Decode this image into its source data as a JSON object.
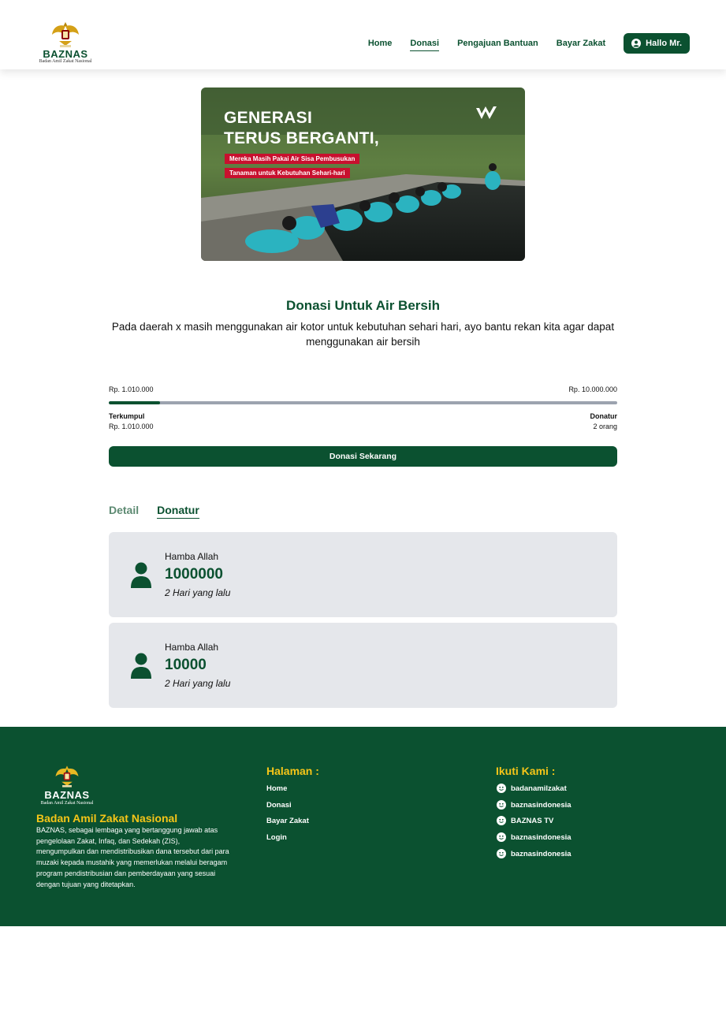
{
  "header": {
    "logo": {
      "brand": "BAZNAS",
      "subtitle": "Badan Amil Zakat Nasional"
    },
    "nav": [
      {
        "label": "Home"
      },
      {
        "label": "Donasi",
        "active": true
      },
      {
        "label": "Pengajuan Bantuan"
      },
      {
        "label": "Bayar Zakat"
      }
    ],
    "user_button": "Hallo Mr."
  },
  "banner": {
    "headline_line1": "GENERASI",
    "headline_line2": "TERUS BERGANTI,",
    "tag1": "Mereka Masih Pakai Air Sisa Pembusukan",
    "tag2": "Tanaman untuk Kebutuhan Sehari-hari"
  },
  "campaign": {
    "title": "Donasi Untuk Air Bersih",
    "description": "Pada daerah x masih menggunakan air kotor untuk kebutuhan sehari hari, ayo bantu rekan kita agar dapat menggunakan air bersih",
    "collected_top": "Rp. 1.010.000",
    "target": "Rp. 10.000.000",
    "progress_fraction": 0.101,
    "collected_label": "Terkumpul",
    "collected_value": "Rp. 1.010.000",
    "donor_label": "Donatur",
    "donor_value": "2 orang",
    "donate_button": "Donasi Sekarang"
  },
  "tabs": [
    {
      "label": "Detail",
      "active": false
    },
    {
      "label": "Donatur",
      "active": true
    }
  ],
  "donors": [
    {
      "name": "Hamba Allah",
      "amount": "1000000",
      "time": "2 Hari yang lalu"
    },
    {
      "name": "Hamba Allah",
      "amount": "10000",
      "time": "2 Hari yang lalu"
    }
  ],
  "footer": {
    "logo": {
      "brand": "BAZNAS",
      "subtitle": "Badan Amil Zakat Nasional"
    },
    "org_name": "Badan Amil Zakat Nasional",
    "org_description": "BAZNAS, sebagai lembaga yang bertanggung jawab atas pengelolaan Zakat, Infaq, dan Sedekah (ZIS), mengumpulkan dan mendistribusikan dana tersebut dari para muzaki kepada mustahik yang memerlukan melalui beragam program pendistribusian dan pemberdayaan yang sesuai dengan tujuan yang ditetapkan.",
    "pages_title": "Halaman :",
    "pages": [
      "Home",
      "Donasi",
      "Bayar Zakat",
      "Login"
    ],
    "social_title": "Ikuti Kami :",
    "social": [
      "badanamilzakat",
      "baznasindonesia",
      "BAZNAS TV",
      "baznasindonesia",
      "baznasindonesia"
    ]
  },
  "colors": {
    "primary": "#0b5130",
    "accent": "#f5c518",
    "card": "#e5e7eb",
    "track": "#9ca3af"
  }
}
